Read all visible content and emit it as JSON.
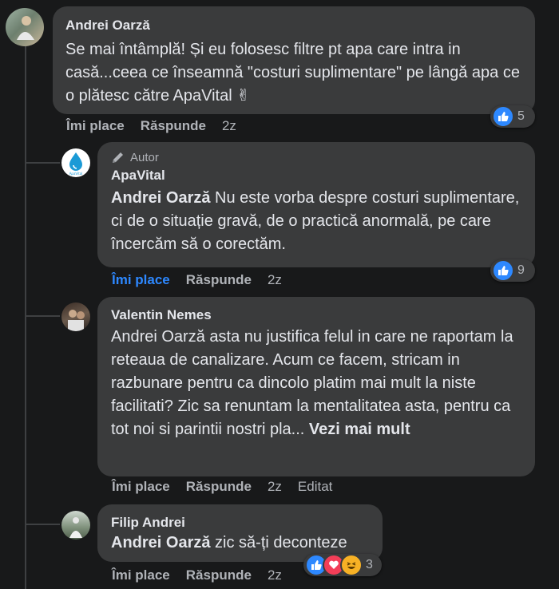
{
  "comments": [
    {
      "author": "Andrei Oarză",
      "text": "Se mai întâmplă! Și eu folosesc filtre pt apa care intra in casă...ceea ce înseamnă \"costuri suplimentare\" pe lângă apa ce o plătesc către ApaVital ✌",
      "like_label": "Îmi place",
      "reply_label": "Răspunde",
      "time": "2z",
      "reaction_count": "5"
    },
    {
      "badge": "Autor",
      "author": "ApaVital",
      "mention": "Andrei Oarză",
      "text": " Nu este vorba despre costuri suplimentare, ci de o situație gravă, de o practică anormală, pe care încercăm să o corectăm.",
      "like_label": "Îmi place",
      "reply_label": "Răspunde",
      "time": "2z",
      "reaction_count": "9"
    },
    {
      "author": "Valentin Nemes",
      "text": "Andrei Oarză asta nu justifica felul in care ne raportam la reteaua de canalizare. Acum ce facem, stricam in razbunare pentru ca dincolo platim mai mult la niste facilitati? Zic sa renuntam la mentalitatea asta, pentru ca tot noi si parintii nostri pla... ",
      "see_more": "Vezi mai mult",
      "like_label": "Îmi place",
      "reply_label": "Răspunde",
      "time": "2z",
      "edited": "Editat"
    },
    {
      "author": "Filip Andrei",
      "mention": "Andrei Oarză",
      "text": " zic să-ți deconteze",
      "like_label": "Îmi place",
      "reply_label": "Răspunde",
      "time": "2z",
      "reaction_count": "3"
    }
  ],
  "colors": {
    "background": "#18191a",
    "bubble": "#3a3b3c",
    "like_blue": "#2d88ff",
    "love_red": "#f33e58",
    "haha_yellow": "#f7b125"
  }
}
